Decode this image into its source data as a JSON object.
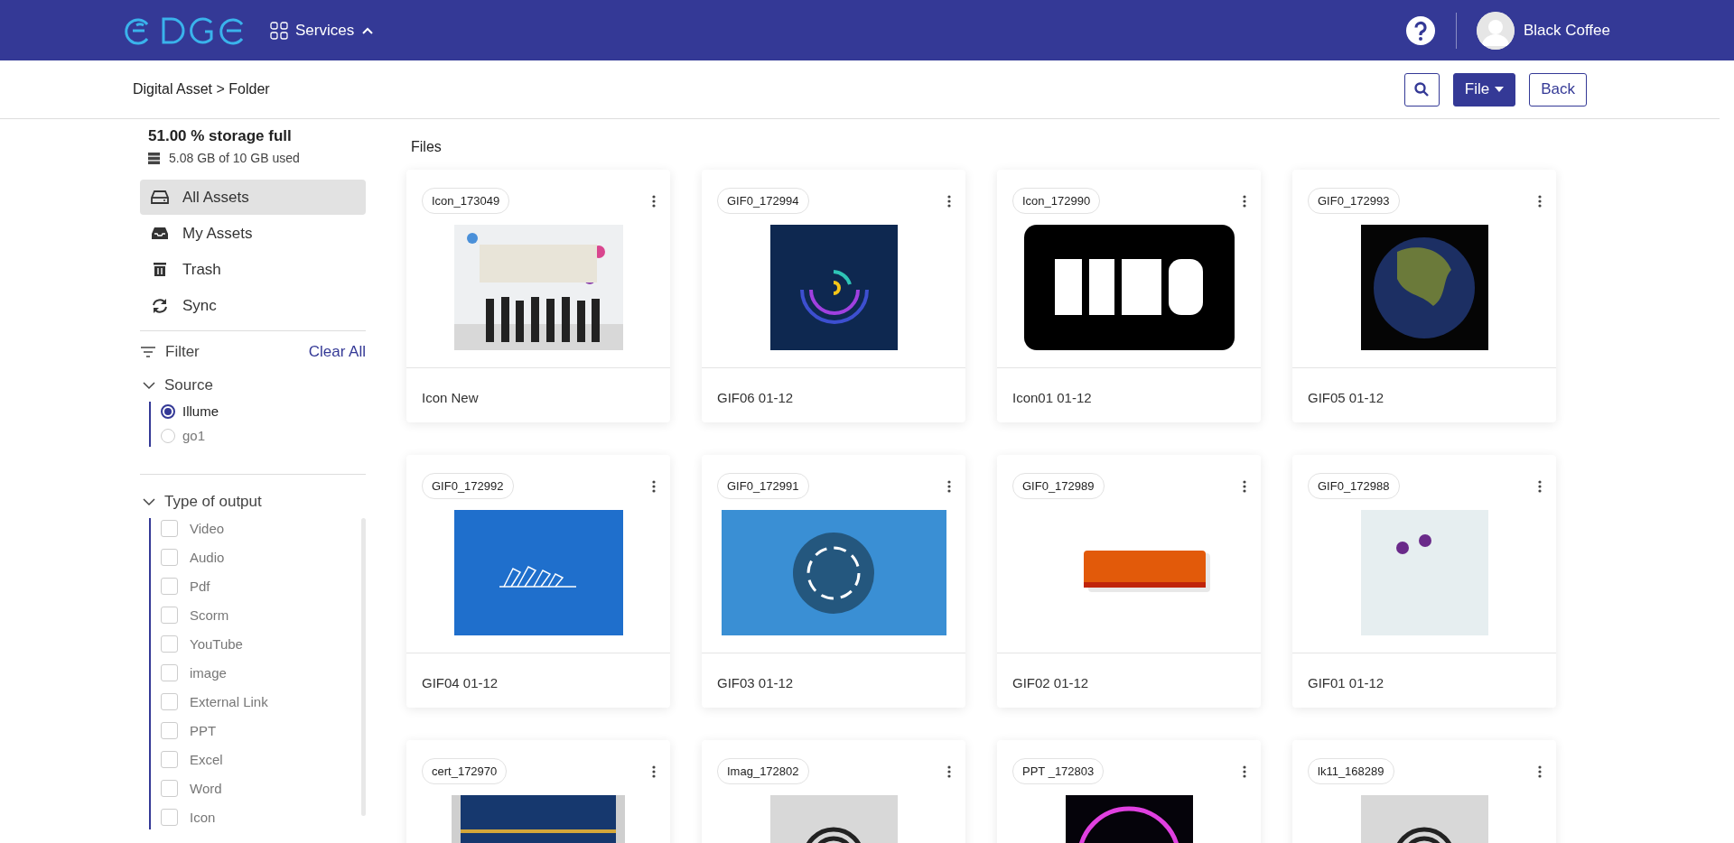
{
  "header": {
    "services": {
      "label": "Services",
      "expanded": true
    },
    "user": "Black Coffee"
  },
  "toolbar": {
    "breadcrumb": "Digital Asset > Folder",
    "file_button": "File",
    "back_button": "Back"
  },
  "sidebar": {
    "storage": {
      "title": "51.00 % storage full",
      "detail": "5.08 GB of 10 GB used"
    },
    "nav": [
      {
        "label": "All Assets",
        "selected": true
      },
      {
        "label": "My Assets",
        "selected": false
      },
      {
        "label": "Trash",
        "selected": false
      },
      {
        "label": "Sync",
        "selected": false
      }
    ],
    "filter": {
      "label": "Filter",
      "clear": "Clear All"
    },
    "sections": [
      {
        "title": "Source",
        "kind": "radio",
        "expanded": true,
        "options": [
          {
            "label": "Illume",
            "selected": true
          },
          {
            "label": "go1",
            "selected": false
          }
        ]
      },
      {
        "title": "Type of output",
        "kind": "checkbox",
        "expanded": true,
        "options": [
          {
            "label": "Video",
            "checked": false
          },
          {
            "label": "Audio",
            "checked": false
          },
          {
            "label": "Pdf",
            "checked": false
          },
          {
            "label": "Scorm",
            "checked": false
          },
          {
            "label": "YouTube",
            "checked": false
          },
          {
            "label": "image",
            "checked": false
          },
          {
            "label": "External Link",
            "checked": false
          },
          {
            "label": "PPT",
            "checked": false
          },
          {
            "label": "Excel",
            "checked": false
          },
          {
            "label": "Word",
            "checked": false
          },
          {
            "label": "Icon",
            "checked": false
          }
        ]
      }
    ]
  },
  "files": {
    "heading": "Files",
    "cards": [
      {
        "tag": "Icon_173049",
        "title": "Icon New"
      },
      {
        "tag": "GIF0_172994",
        "title": "GIF06 01-12"
      },
      {
        "tag": "Icon_172990",
        "title": "Icon01 01-12"
      },
      {
        "tag": "GIF0_172993",
        "title": "GIF05 01-12"
      },
      {
        "tag": "GIF0_172992",
        "title": "GIF04 01-12"
      },
      {
        "tag": "GIF0_172991",
        "title": "GIF03 01-12"
      },
      {
        "tag": "GIF0_172989",
        "title": "GIF02 01-12"
      },
      {
        "tag": "GIF0_172988",
        "title": "GIF01 01-12"
      },
      {
        "tag": "cert_172970"
      },
      {
        "tag": "Imag_172802"
      },
      {
        "tag": "PPT _172803"
      },
      {
        "tag": "lk11_168289"
      }
    ]
  }
}
